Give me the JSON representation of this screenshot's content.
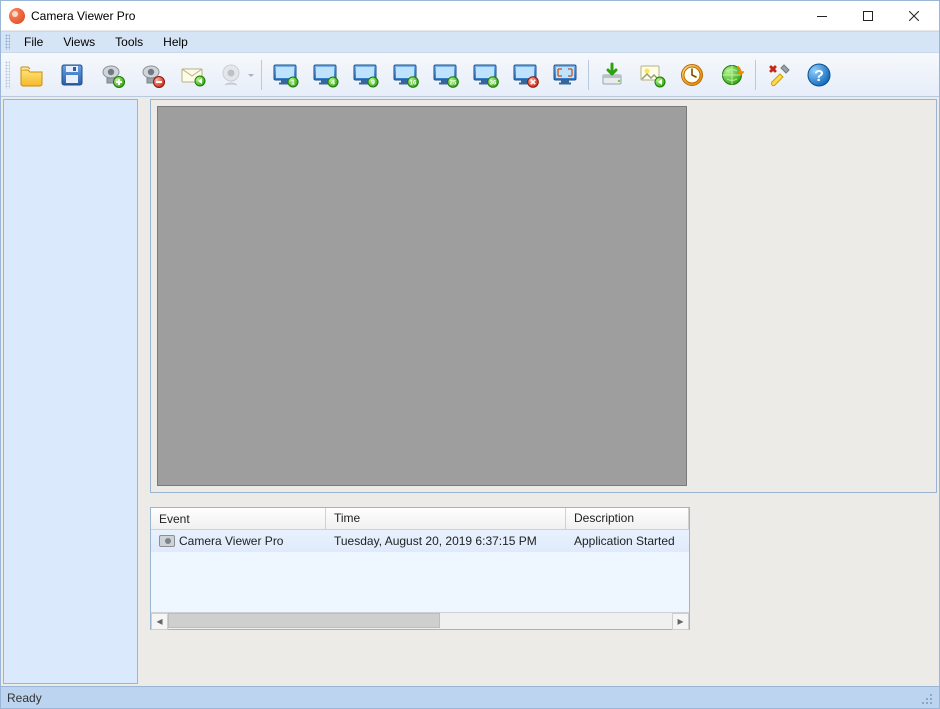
{
  "window": {
    "title": "Camera Viewer Pro"
  },
  "menu": {
    "file": "File",
    "views": "Views",
    "tools": "Tools",
    "help": "Help"
  },
  "toolbar": {
    "open_folder": "open-folder",
    "save": "save",
    "add_camera": "add-camera",
    "remove_camera": "remove-camera",
    "email": "email",
    "webcam": "webcam",
    "grid1": "grid-1",
    "grid4": "grid-4",
    "grid9": "grid-9",
    "grid16": "grid-16",
    "grid25": "grid-25",
    "grid36": "grid-36",
    "monitor_off": "monitor-off",
    "fullscreen": "fullscreen",
    "download": "download",
    "export": "export",
    "schedule": "schedule",
    "refresh": "refresh",
    "settings": "settings",
    "help": "help"
  },
  "events_table": {
    "headers": {
      "event": "Event",
      "time": "Time",
      "description": "Description"
    },
    "row0": {
      "event": "Camera Viewer Pro",
      "time": "Tuesday, August 20, 2019 6:37:15 PM",
      "description": "Application Started"
    }
  },
  "status": {
    "text": "Ready"
  }
}
